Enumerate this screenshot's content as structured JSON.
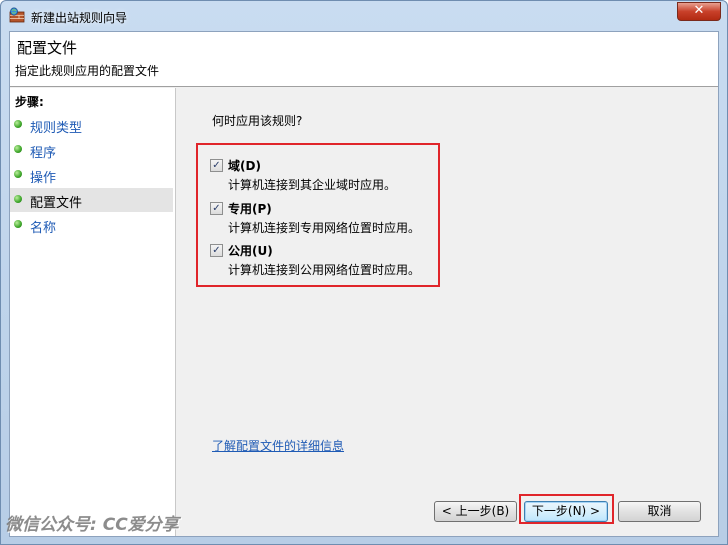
{
  "window": {
    "title": "新建出站规则向导",
    "close_label": "✕"
  },
  "header": {
    "title": "配置文件",
    "subtitle": "指定此规则应用的配置文件"
  },
  "sidebar": {
    "heading": "步骤:",
    "steps": [
      {
        "label": "规则类型",
        "selected": false
      },
      {
        "label": "程序",
        "selected": false
      },
      {
        "label": "操作",
        "selected": false
      },
      {
        "label": "配置文件",
        "selected": true
      },
      {
        "label": "名称",
        "selected": false
      }
    ]
  },
  "main": {
    "question": "何时应用该规则?",
    "options": [
      {
        "label": "域(D)",
        "description": "计算机连接到其企业域时应用。",
        "checked": true
      },
      {
        "label": "专用(P)",
        "description": "计算机连接到专用网络位置时应用。",
        "checked": true
      },
      {
        "label": "公用(U)",
        "description": "计算机连接到公用网络位置时应用。",
        "checked": true
      }
    ],
    "learn_more_link": "了解配置文件的详细信息"
  },
  "buttons": {
    "back": "< 上一步(B)",
    "next": "下一步(N) >",
    "cancel": "取消"
  },
  "watermark": "微信公众号: CC爱分享",
  "colors": {
    "highlight": "#e0252a",
    "link": "#1f5bb5",
    "step_dot": "#3ea62a"
  },
  "icons": {
    "title_icon": "firewall-icon",
    "step_icon": "green-bullet-icon",
    "checkbox": "check-icon"
  }
}
